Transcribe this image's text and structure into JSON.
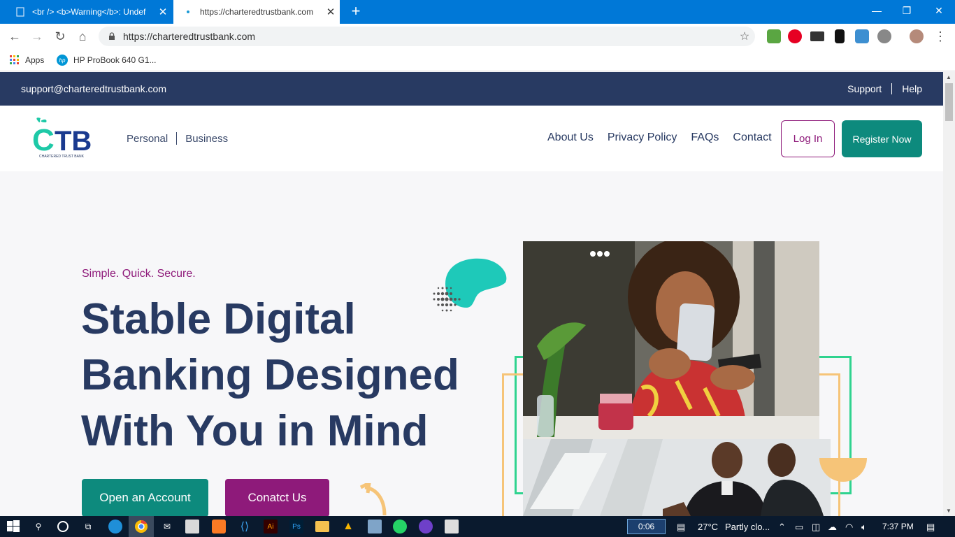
{
  "browser": {
    "tabs": [
      {
        "title": "<br /> <b>Warning</b>: Undef",
        "active": false
      },
      {
        "title": "https://charteredtrustbank.com",
        "active": true
      }
    ],
    "url": "https://charteredtrustbank.com",
    "bookmarks": [
      {
        "label": "Apps",
        "icon": "apps-grid-icon"
      },
      {
        "label": "HP ProBook 640 G1...",
        "icon": "hp-icon"
      }
    ]
  },
  "site": {
    "topbar": {
      "email": "support@charteredtrustbank.com",
      "links": [
        "Support",
        "Help"
      ]
    },
    "logo": {
      "text": "CTB",
      "subtitle": "CHARTERED TRUST BANK"
    },
    "segments": [
      "Personal",
      "Business"
    ],
    "nav": [
      "About Us",
      "Privacy Policy",
      "FAQs",
      "Contact"
    ],
    "login_label": "Log In",
    "register_label": "Register Now",
    "hero": {
      "tagline": "Simple. Quick. Secure.",
      "title": "Stable Digital Banking Designed With You in Mind",
      "open_account_label": "Open an Account",
      "contact_label": "Conatct Us"
    },
    "colors": {
      "navy": "#283a62",
      "teal": "#0d8a7d",
      "purple": "#8e1a7a",
      "accent_green": "#2fd38f",
      "accent_orange": "#f6c478"
    }
  },
  "taskbar": {
    "timer": "0:06",
    "weather": "27°C",
    "weather_desc": "Partly clo...",
    "clock": "7:37 PM"
  }
}
